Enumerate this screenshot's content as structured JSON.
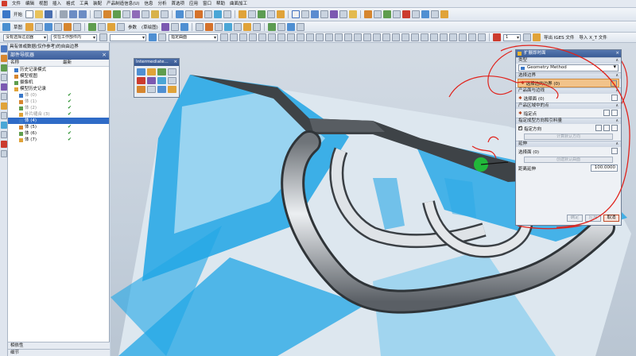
{
  "menubar": {
    "items": [
      "文件",
      "编辑",
      "视图",
      "插入",
      "格式",
      "工具",
      "装配",
      "产品制造信息(U)",
      "信息",
      "分析",
      "首选项",
      "应用",
      "窗口",
      "帮助",
      "曲面加工"
    ]
  },
  "toolbar1": {
    "start_label": "开始",
    "icons": [
      "new-icon",
      "open-icon",
      "save-icon",
      "cut-icon",
      "undo-icon",
      "redo-icon",
      "show-hide-icon",
      "fit-icon",
      "render-icon"
    ]
  },
  "toolbar2": {
    "sketch_label": "草图",
    "params_label": "参数",
    "params_note": "(草绘图)"
  },
  "toolbar3": {
    "filter_combo": "没有选择过滤器",
    "scope_combo": "仅在工作部件内",
    "select_combo": "",
    "snap_combo": "指定曲面",
    "layer_value": "1",
    "import_iges": "导出 IGES 文件",
    "import_menu": "导入 X_T 文件"
  },
  "navigator": {
    "path": "具有体或数据(仅作参考)的自由边界",
    "title": "部件导航器",
    "col_name": "名称",
    "col_latest": "最新",
    "rows": [
      {
        "label": "历史记录模式",
        "indent": 1,
        "check": false,
        "selected": false,
        "dim": false
      },
      {
        "label": "模型视图",
        "indent": 1,
        "check": false,
        "selected": false,
        "dim": false
      },
      {
        "label": "摄像机",
        "indent": 1,
        "check": false,
        "selected": false,
        "dim": false
      },
      {
        "label": "模型历史记录",
        "indent": 1,
        "check": false,
        "selected": false,
        "dim": false
      },
      {
        "label": "体 (0)",
        "indent": 2,
        "check": true,
        "selected": false,
        "dim": true
      },
      {
        "label": "体 (1)",
        "indent": 2,
        "check": true,
        "selected": false,
        "dim": true
      },
      {
        "label": "体 (2)",
        "indent": 2,
        "check": true,
        "selected": false,
        "dim": true
      },
      {
        "label": "补片缝合 (3)",
        "indent": 2,
        "check": true,
        "selected": false,
        "dim": true
      },
      {
        "label": "体 (4)",
        "indent": 2,
        "check": false,
        "selected": true,
        "dim": false
      },
      {
        "label": "体 (5)",
        "indent": 2,
        "check": true,
        "selected": false,
        "dim": false
      },
      {
        "label": "体 (6)",
        "indent": 2,
        "check": true,
        "selected": false,
        "dim": false
      },
      {
        "label": "体 (7)",
        "indent": 2,
        "check": true,
        "selected": false,
        "dim": false
      }
    ],
    "bottom1": "相依性",
    "bottom2": "细节"
  },
  "intermediate": {
    "title": "Intermediate..."
  },
  "dialog": {
    "title": "扩展即时面",
    "type_header": "类型",
    "type_value": "Geometry Method",
    "boundary_header": "选择边界",
    "boundary_row": "选择边的边界 (0)",
    "face_header": "产品面与边线",
    "face_row": "选择面 (0)",
    "vector_header": "产品区域中的点",
    "vector_row": "指定点",
    "ref_header": "指定成型方向和引料量",
    "ref_check": "指定方向",
    "ref_btn": "计算默认方向",
    "settings_header": "延伸",
    "settings_row": "选择面 (0)",
    "settings_btn": "创建默认曲面",
    "dist_label": "距离延伸",
    "dist_value": "100.0000",
    "ok": "确定",
    "apply": "应用",
    "cancel": "取消"
  },
  "colors": {
    "accent_blue": "#1fa6e6",
    "annotation_red": "#e0221b",
    "selection_green": "#21b83a"
  }
}
